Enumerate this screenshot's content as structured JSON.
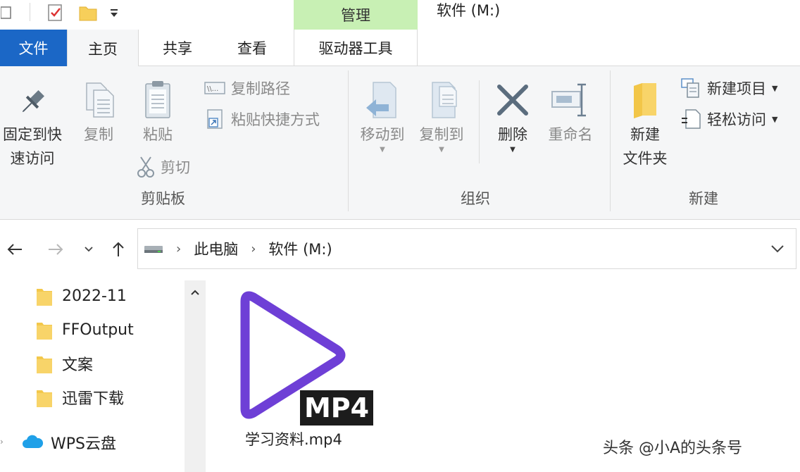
{
  "title_bar": {
    "manage_tab": "管理",
    "window_title": "软件 (M:)"
  },
  "tabs": {
    "file": "文件",
    "home": "主页",
    "share": "共享",
    "view": "查看",
    "drive_tools": "驱动器工具"
  },
  "ribbon": {
    "clipboard": {
      "pin_line1": "固定到快",
      "pin_line2": "速访问",
      "copy": "复制",
      "paste": "粘贴",
      "copy_path": "复制路径",
      "paste_shortcut": "粘贴快捷方式",
      "cut": "剪切",
      "group_label": "剪贴板"
    },
    "organize": {
      "move_to": "移动到",
      "copy_to": "复制到",
      "delete": "删除",
      "rename": "重命名",
      "group_label": "组织"
    },
    "new": {
      "new_folder_line1": "新建",
      "new_folder_line2": "文件夹",
      "new_item": "新建项目",
      "easy_access": "轻松访问",
      "group_label": "新建"
    }
  },
  "address": {
    "crumbs": [
      "此电脑",
      "软件 (M:)"
    ]
  },
  "nav_pane": {
    "items": [
      {
        "label": "2022-11"
      },
      {
        "label": "FFOutput"
      },
      {
        "label": "文案"
      },
      {
        "label": "迅雷下载"
      },
      {
        "label": "WPS云盘"
      }
    ]
  },
  "content": {
    "files": [
      {
        "name": "学习资料.mp4",
        "badge": "MP4"
      }
    ]
  },
  "watermark": "头条 @小A的头条号",
  "colors": {
    "file_tab": "#1b67c6",
    "manage_ctx": "#c8f0b4",
    "play_icon": "#6e3fd6",
    "ribbon_bg": "#f5f6f7"
  }
}
